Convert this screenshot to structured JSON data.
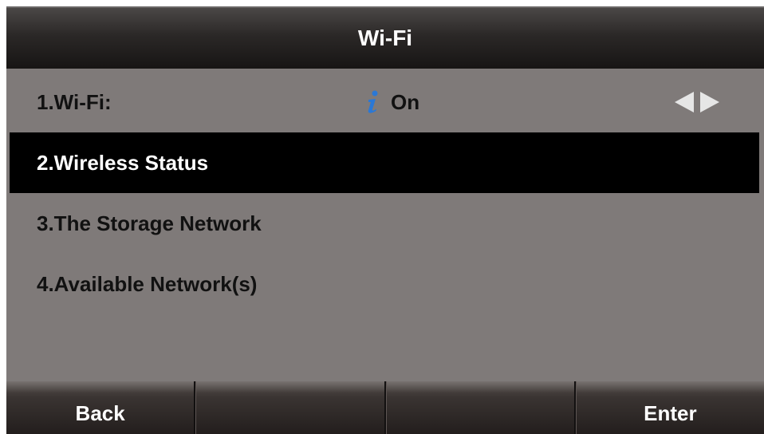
{
  "header": {
    "title": "Wi-Fi"
  },
  "menu": {
    "items": [
      {
        "label": "1.Wi-Fi:",
        "value": "On",
        "icon": "info-icon",
        "selected": false
      },
      {
        "label": "2.Wireless Status",
        "selected": true
      },
      {
        "label": "3.The Storage Network",
        "selected": false
      },
      {
        "label": "4.Available Network(s)",
        "selected": false
      }
    ]
  },
  "softkeys": [
    {
      "label": "Back"
    },
    {
      "label": ""
    },
    {
      "label": ""
    },
    {
      "label": "Enter"
    }
  ],
  "colors": {
    "menu_background": "#7f7a79",
    "selected_background": "#000000",
    "info_icon": "#2a78d6",
    "arrow_color": "#e6e6e6"
  }
}
